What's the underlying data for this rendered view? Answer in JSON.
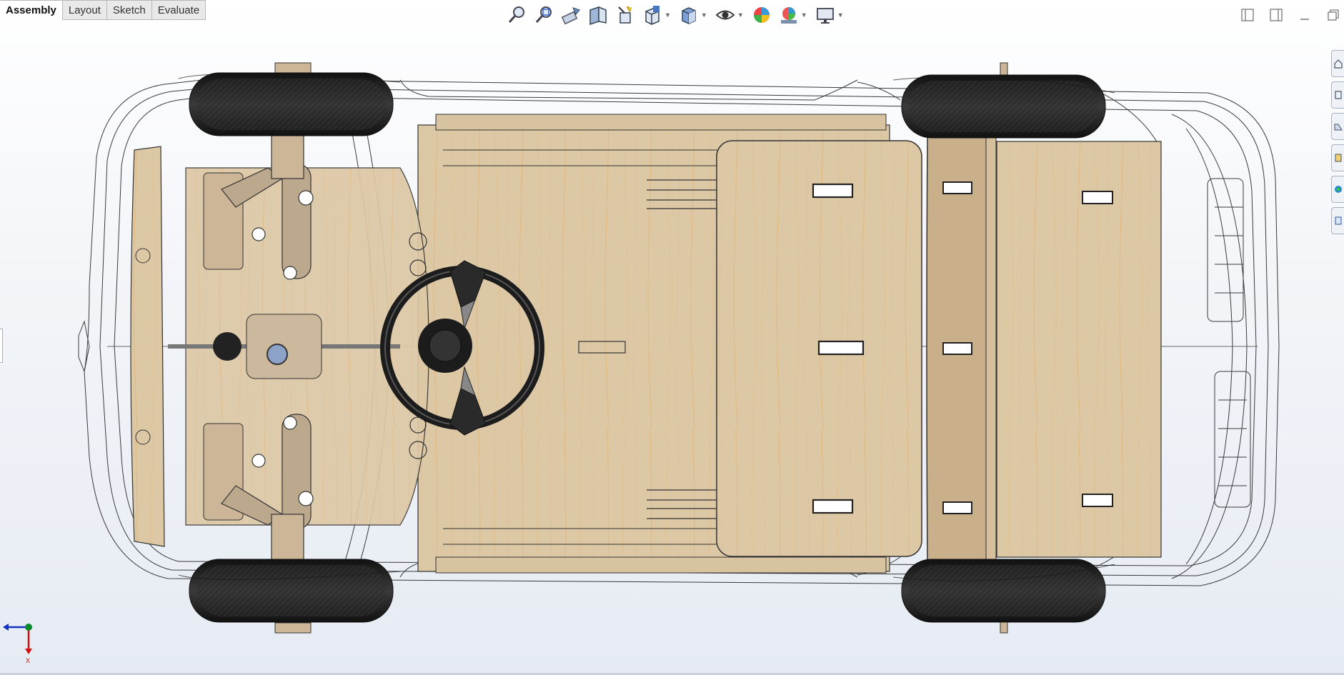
{
  "tabs": [
    {
      "label": "Assembly",
      "active": true
    },
    {
      "label": "Layout",
      "active": false
    },
    {
      "label": "Sketch",
      "active": false
    },
    {
      "label": "Evaluate",
      "active": false
    }
  ],
  "hud_icons": [
    "zoom-to-fit-icon",
    "zoom-to-area-icon",
    "previous-view-icon",
    "section-view-icon",
    "dynamic-annotation-icon",
    "view-orientation-icon",
    "display-style-icon",
    "hide-show-items-icon",
    "edit-appearance-icon",
    "apply-scene-icon",
    "view-settings-icon"
  ],
  "window_controls": [
    "tile-left-icon",
    "tile-right-icon",
    "minimize-icon",
    "restore-icon"
  ],
  "task_pane_icons": [
    "home-icon",
    "design-library-icon",
    "file-explorer-icon",
    "view-palette-icon",
    "appearances-icon",
    "custom-properties-icon"
  ],
  "triad": {
    "x_label": "X",
    "x_color": "#d01010",
    "y_color": "#1030c0",
    "origin_color": "#0a8a2a"
  },
  "colors": {
    "wood": "#ddc8a6",
    "wood_dark": "#c9b08a",
    "tire": "#222222",
    "wire": "#1a1a1a",
    "metal": "#b9a58c"
  }
}
